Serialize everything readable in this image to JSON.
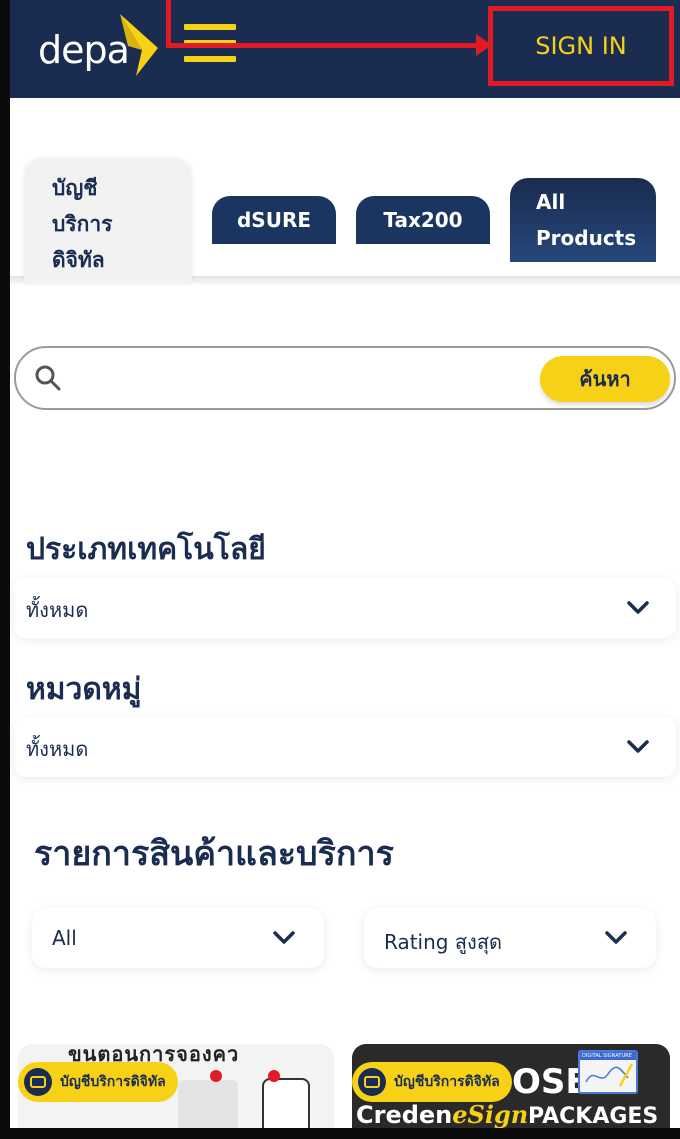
{
  "header": {
    "logo_text": "depa",
    "sign_in_label": "SIGN IN",
    "colors": {
      "navy": "#1a2c4f",
      "yellow": "#f7d116",
      "annotation_red": "#e01b24"
    }
  },
  "tabs": {
    "active": {
      "line1": "บัญชี",
      "line2": "บริการ",
      "line3": "ดิจิทัล"
    },
    "dsure": "dSURE",
    "tax200": "Tax200",
    "all_products": {
      "line1": "All",
      "line2": "Products"
    }
  },
  "search": {
    "placeholder": "",
    "button_label": "ค้นหา",
    "icon": "search-icon"
  },
  "filters": {
    "technology_type": {
      "title": "ประเภทเทคโนโลยี",
      "value": "ทั้งหมด"
    },
    "category": {
      "title": "หมวดหมู่",
      "value": "ทั้งหมด"
    }
  },
  "products": {
    "title": "รายการสินค้าและบริการ",
    "sort_filter": "All",
    "rating_filter": "Rating สูงสุด"
  },
  "cards": [
    {
      "badge": "บัญชีบริการดิจิทัล",
      "headline": "ขนตอนการจองคว"
    },
    {
      "badge": "บัญชีบริการดิจิทัล",
      "headline": "OSE",
      "brand_main": "Creden",
      "brand_sub": "eSign",
      "packages": "PACKAGES",
      "sig_label": "DIGITAL SIGNATURE"
    }
  ]
}
